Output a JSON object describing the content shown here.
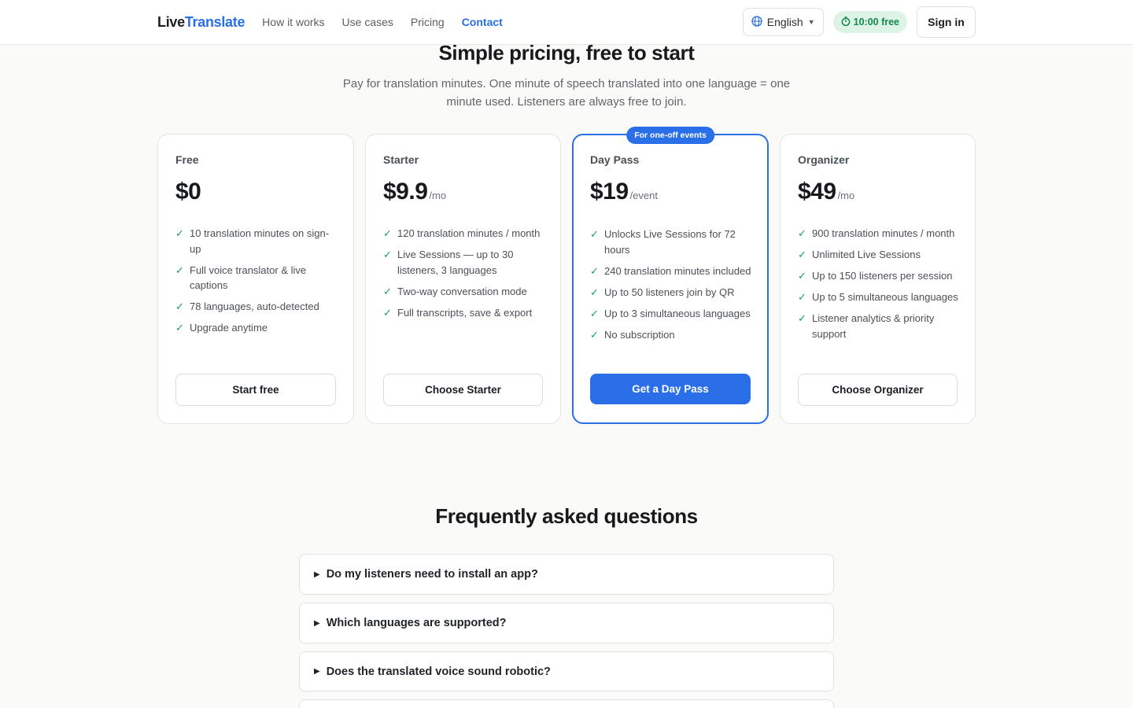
{
  "header": {
    "logo_part1": "Live",
    "logo_part2": "Translate",
    "nav": [
      {
        "label": "How it works"
      },
      {
        "label": "Use cases"
      },
      {
        "label": "Pricing"
      },
      {
        "label": "Contact"
      }
    ],
    "active_nav": "Contact",
    "language": "English",
    "free_time": "10:00 free",
    "sign_in": "Sign in"
  },
  "pricing": {
    "title": "Simple pricing, free to start",
    "subtitle": "Pay for translation minutes. One minute of speech translated into one language = one minute used. Listeners are always free to join.",
    "plans": [
      {
        "name": "Free",
        "price": "$0",
        "period": "",
        "features": [
          "10 translation minutes on sign-up",
          "Full voice translator & live captions",
          "78 languages, auto-detected",
          "Upgrade anytime"
        ],
        "cta": "Start free"
      },
      {
        "name": "Starter",
        "price": "$9.9",
        "period": "/mo",
        "features": [
          "120 translation minutes / month",
          "Live Sessions — up to 30 listeners, 3 languages",
          "Two-way conversation mode",
          "Full transcripts, save & export"
        ],
        "cta": "Choose Starter"
      },
      {
        "name": "Day Pass",
        "price": "$19",
        "period": "/event",
        "badge": "For one-off events",
        "features": [
          "Unlocks Live Sessions for 72 hours",
          "240 translation minutes included",
          "Up to 50 listeners join by QR",
          "Up to 3 simultaneous languages",
          "No subscription"
        ],
        "cta": "Get a Day Pass"
      },
      {
        "name": "Organizer",
        "price": "$49",
        "period": "/mo",
        "features": [
          "900 translation minutes / month",
          "Unlimited Live Sessions",
          "Up to 150 listeners per session",
          "Up to 5 simultaneous languages",
          "Listener analytics & priority support"
        ],
        "cta": "Choose Organizer"
      }
    ]
  },
  "faq": {
    "title": "Frequently asked questions",
    "items": [
      {
        "question": "Do my listeners need to install an app?"
      },
      {
        "question": "Which languages are supported?"
      },
      {
        "question": "Does the translated voice sound robotic?"
      }
    ]
  },
  "icons": {
    "check": "check-icon",
    "globe": "globe-icon",
    "timer": "timer-icon",
    "caret": "chevron-down-icon",
    "disclosure": "triangle-right-icon"
  },
  "colors": {
    "accent": "#2b6fe8",
    "check_green": "#18a05c",
    "free_pill_bg": "#dcf3e6",
    "free_pill_text": "#128a4e"
  }
}
